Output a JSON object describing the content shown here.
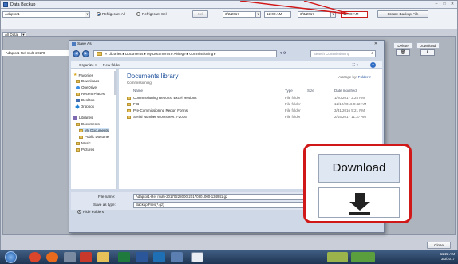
{
  "app": {
    "title": "Data Backup",
    "controls": [
      "–",
      "□",
      "✕"
    ]
  },
  "toolbar": {
    "device_combo": "Adaptor1",
    "filter_combo": "All Data",
    "radio_all": "Refrigerant All",
    "radio_sel": "Refrigerant Sel",
    "sel_button": "Sel",
    "start_date": "3/2/2017",
    "start_time": "12:00 AM",
    "end_date": "3/3/2017",
    "end_time": "12:00 AM",
    "create_button": "Create Backup File"
  },
  "grid": {
    "row_text": "Adaptor1-Ref multi-20170",
    "col_delete": "Delete",
    "col_download": "Download"
  },
  "close_button": "Close",
  "dialog": {
    "title": "Save As",
    "close": "✕",
    "breadcrumb": "« Libraries ▸ Documents ▸ My Documents ▸ Airitege ▸ Commissioning ▸",
    "search_placeholder": "Search Commissioning",
    "organize": "Organize ▾",
    "new_folder": "New folder",
    "nav": {
      "favorites": "Favorites",
      "downloads": "Downloads",
      "onedrive": "OneDrive",
      "recent": "Recent Places",
      "desktop": "Desktop",
      "dropbox": "Dropbox",
      "libraries": "Libraries",
      "documents": "Documents",
      "mydocs": "My Documents",
      "publicdocs": "Public Docume",
      "music": "Music",
      "pictures": "Pictures"
    },
    "library_title": "Documents library",
    "library_sub": "Commissioning",
    "arrange_label": "Arrange by:",
    "arrange_value": "Folder ▾",
    "headers": {
      "name": "Name",
      "type": "Type",
      "size": "Size",
      "date": "Date modified"
    },
    "files": [
      {
        "name": "Commissioning Reports- Excel versions",
        "type": "File folder",
        "date": "1/20/2017 2:25 PM"
      },
      {
        "name": "F-B",
        "type": "File folder",
        "date": "12/12/2016 9:42 AM"
      },
      {
        "name": "Pre-Commissioning Report Forms",
        "type": "File folder",
        "date": "3/31/2016 5:21 PM"
      },
      {
        "name": "Serial Number Worksheet 2-2016",
        "type": "File folder",
        "date": "2/15/2017 11:37 AM"
      }
    ],
    "file_name_label": "File name:",
    "file_name_value": "Adaptor1-Ref multi-20170228000-20170301000-134941.gz",
    "save_type_label": "Save as type:",
    "save_type_value": "Backup Files(*.gz)",
    "hide_folders": "Hide Folders"
  },
  "callout": {
    "header": "Download"
  },
  "taskbar": {
    "time": "11:22 AM",
    "date": "3/3/2017"
  }
}
